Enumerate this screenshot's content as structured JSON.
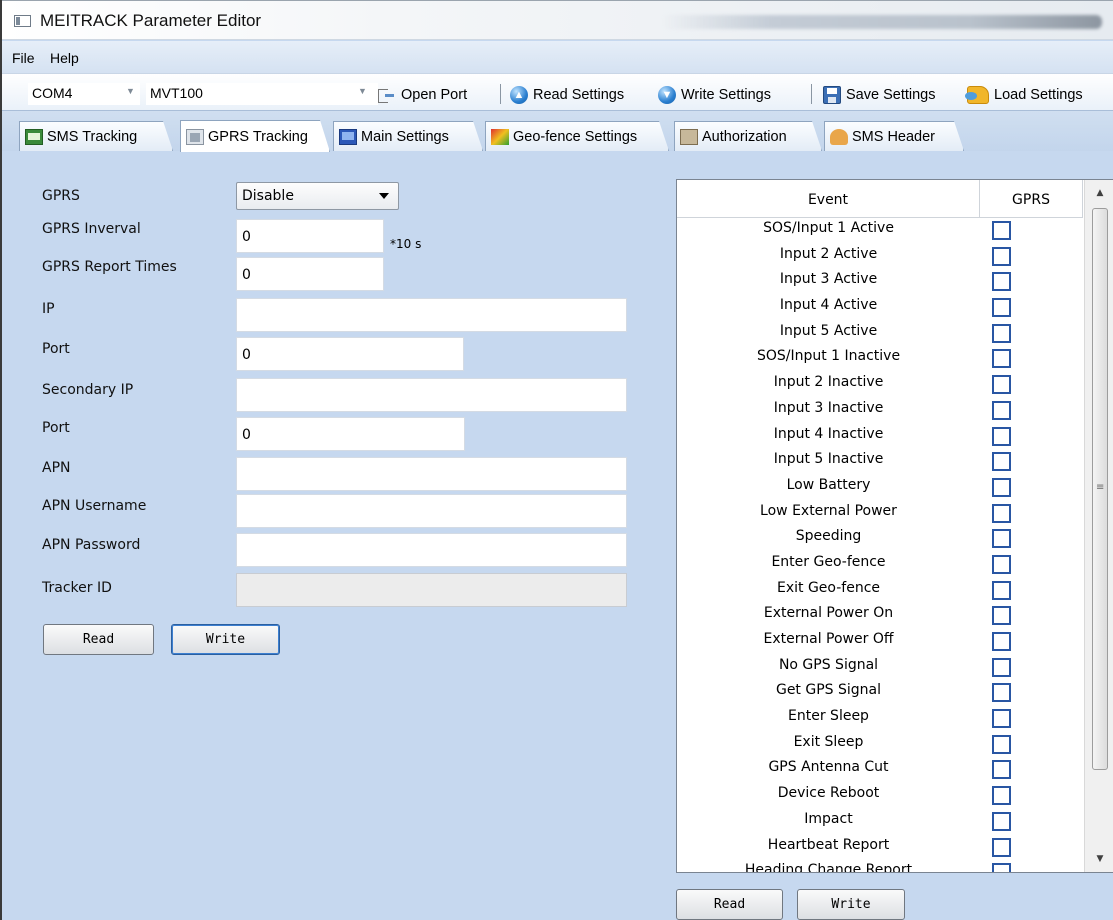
{
  "window": {
    "title": "MEITRACK Parameter Editor"
  },
  "menu": {
    "file": "File",
    "help": "Help"
  },
  "toolbar": {
    "com_port": "COM4",
    "device_model": "MVT100",
    "open_port": "Open Port",
    "read_settings": "Read Settings",
    "write_settings": "Write Settings",
    "save_settings": "Save Settings",
    "load_settings": "Load Settings"
  },
  "tabs": [
    {
      "label": "SMS Tracking",
      "icon": "sms-icon"
    },
    {
      "label": "GPRS Tracking",
      "icon": "gprs-icon",
      "active": true
    },
    {
      "label": "Main Settings",
      "icon": "monitor-icon"
    },
    {
      "label": "Geo-fence Settings",
      "icon": "map-icon"
    },
    {
      "label": "Authorization",
      "icon": "authorization-icon"
    },
    {
      "label": "SMS Header",
      "icon": "person-icon"
    }
  ],
  "form": {
    "gprs_label": "GPRS",
    "gprs_value": "Disable",
    "interval_label": "GPRS Inverval",
    "interval_value": "0",
    "interval_unit": "*10 s",
    "report_times_label": "GPRS Report Times",
    "report_times_value": "0",
    "ip_label": "IP",
    "ip_value": "",
    "port_label": "Port",
    "port_value": "0",
    "secondary_ip_label": "Secondary IP",
    "secondary_ip_value": "",
    "secondary_port_label": "Port",
    "secondary_port_value": "0",
    "apn_label": "APN",
    "apn_value": "",
    "apn_username_label": "APN Username",
    "apn_username_value": "",
    "apn_password_label": "APN Password",
    "apn_password_value": "",
    "tracker_id_label": "Tracker ID",
    "tracker_id_value": "",
    "read_button": "Read",
    "write_button": "Write"
  },
  "events": {
    "header_event": "Event",
    "header_gprs": "GPRS",
    "rows": [
      {
        "name": "SOS/Input 1 Active",
        "checked": false
      },
      {
        "name": "Input 2 Active",
        "checked": false
      },
      {
        "name": "Input 3 Active",
        "checked": false
      },
      {
        "name": "Input 4 Active",
        "checked": false
      },
      {
        "name": "Input 5 Active",
        "checked": false
      },
      {
        "name": "SOS/Input 1 Inactive",
        "checked": false
      },
      {
        "name": "Input 2 Inactive",
        "checked": false
      },
      {
        "name": "Input 3 Inactive",
        "checked": false
      },
      {
        "name": "Input 4 Inactive",
        "checked": false
      },
      {
        "name": "Input 5 Inactive",
        "checked": false
      },
      {
        "name": "Low Battery",
        "checked": false
      },
      {
        "name": "Low External Power",
        "checked": false
      },
      {
        "name": "Speeding",
        "checked": false
      },
      {
        "name": "Enter Geo-fence",
        "checked": false
      },
      {
        "name": "Exit Geo-fence",
        "checked": false
      },
      {
        "name": "External Power On",
        "checked": false
      },
      {
        "name": "External Power Off",
        "checked": false
      },
      {
        "name": "No GPS Signal",
        "checked": false
      },
      {
        "name": "Get GPS Signal",
        "checked": false
      },
      {
        "name": "Enter Sleep",
        "checked": false
      },
      {
        "name": "Exit Sleep",
        "checked": false
      },
      {
        "name": "GPS Antenna Cut",
        "checked": false
      },
      {
        "name": "Device Reboot",
        "checked": false
      },
      {
        "name": "Impact",
        "checked": false
      },
      {
        "name": "Heartbeat Report",
        "checked": false
      },
      {
        "name": "Heading Change Report",
        "checked": false
      }
    ],
    "read_button": "Read",
    "write_button": "Write"
  },
  "colors": {
    "background": "#c6d8ef",
    "checkbox_border": "#2956a3"
  }
}
